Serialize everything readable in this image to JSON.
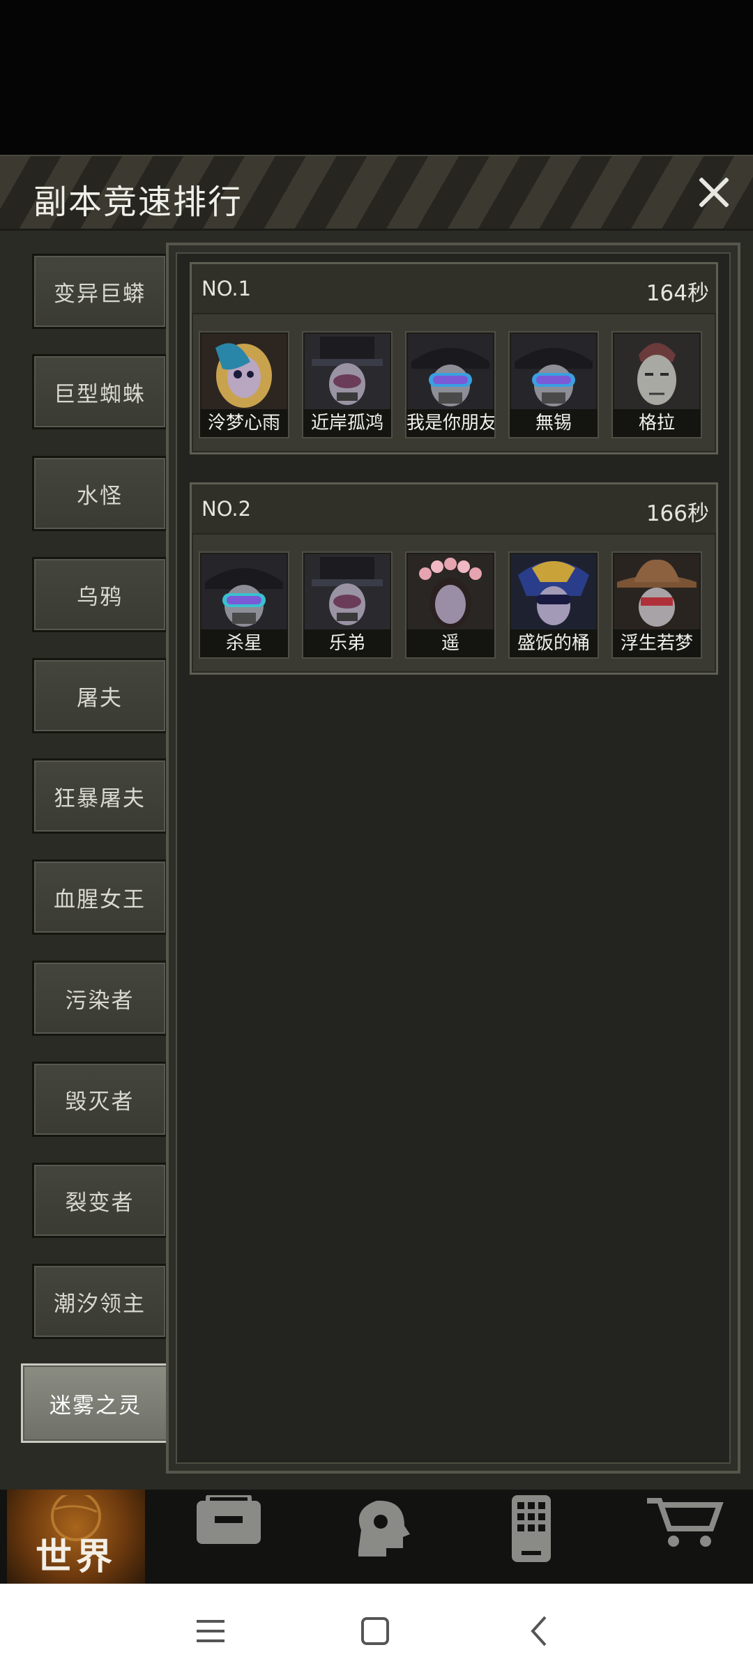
{
  "dialog": {
    "title": "副本竞速排行"
  },
  "bosses": [
    "变异巨蟒",
    "巨型蜘蛛",
    "水怪",
    "乌鸦",
    "屠夫",
    "狂暴屠夫",
    "血腥女王",
    "污染者",
    "毁灭者",
    "裂变者",
    "潮汐领主",
    "迷雾之灵"
  ],
  "active_boss": "迷雾之灵",
  "rankings": [
    {
      "rank": "NO.1",
      "time": "164秒",
      "players": [
        {
          "name": "泠梦心雨",
          "avatar": "blonde-feather-mask-avatar"
        },
        {
          "name": "近岸孤鸿",
          "avatar": "top-hat-masked-avatar"
        },
        {
          "name": "我是你朋友",
          "avatar": "goggles-hat-avatar"
        },
        {
          "name": "無锡",
          "avatar": "goggles-hat-avatar"
        },
        {
          "name": "格拉",
          "avatar": "mohawk-man-avatar"
        }
      ]
    },
    {
      "rank": "NO.2",
      "time": "166秒",
      "players": [
        {
          "name": "杀星",
          "avatar": "goggles-hat-avatar"
        },
        {
          "name": "乐弟",
          "avatar": "top-hat-masked-avatar"
        },
        {
          "name": "遥",
          "avatar": "flower-crown-avatar"
        },
        {
          "name": "盛饭的桶",
          "avatar": "peacock-mask-avatar"
        },
        {
          "name": "浮生若梦",
          "avatar": "cowboy-hat-avatar"
        }
      ]
    }
  ],
  "bottom_nav": {
    "world_label": "世界",
    "icons": [
      "world-globe-icon",
      "backpack-icon",
      "head-gear-icon",
      "phone-icon",
      "cart-icon"
    ]
  },
  "colors": {
    "active_tab": "#8b8c82",
    "world_tab": "#a8651c"
  }
}
